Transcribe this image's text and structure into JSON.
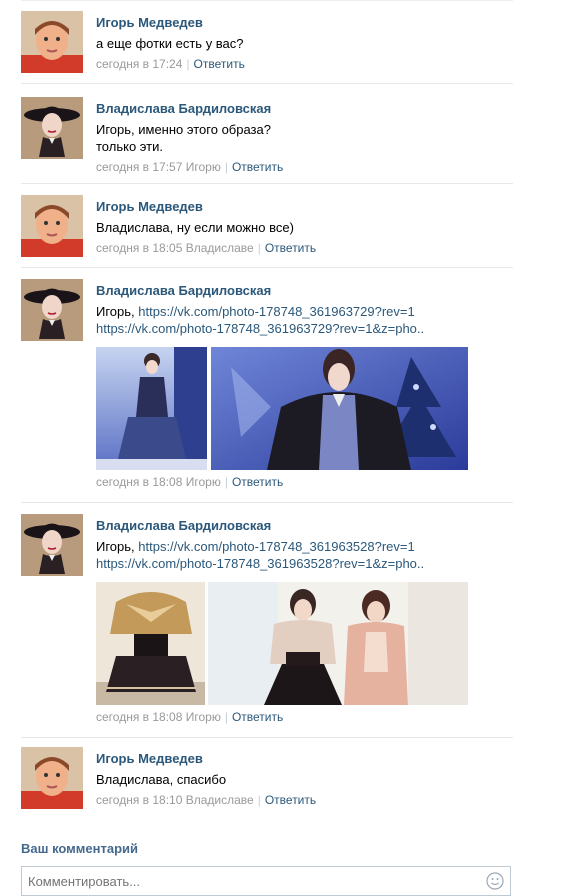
{
  "comments": [
    {
      "author": "Игорь Медведев",
      "avatar": "avatar-igor",
      "text": "а еще фотки есть у вас?",
      "time": "сегодня в 17:24",
      "reply_to": "",
      "reply_label": "Ответить"
    },
    {
      "author": "Владислава Бардиловская",
      "avatar": "avatar-vladislava",
      "text": "Игорь, именно этого образа?\nтолько эти.",
      "time": "сегодня в 17:57 Игорю",
      "reply_label": "Ответить"
    },
    {
      "author": "Игорь Медведев",
      "avatar": "avatar-igor",
      "text": "Владислава, ну если можно все)",
      "time": "сегодня в 18:05 Владиславе",
      "reply_label": "Ответить"
    },
    {
      "author": "Владислава Бардиловская",
      "avatar": "avatar-vladislava",
      "text_prefix": "Игорь, ",
      "link1": "https://vk.com/photo-178748_361963729?rev=1",
      "link2": "https://vk.com/photo-178748_361963729?rev=1&z=pho..",
      "time": "сегодня в 18:08 Игорю",
      "reply_label": "Ответить"
    },
    {
      "author": "Владислава Бардиловская",
      "avatar": "avatar-vladislava",
      "text_prefix": "Игорь, ",
      "link1": "https://vk.com/photo-178748_361963528?rev=1",
      "link2": "https://vk.com/photo-178748_361963528?rev=1&z=pho..",
      "time": "сегодня в 18:08 Игорю",
      "reply_label": "Ответить"
    },
    {
      "author": "Игорь Медведев",
      "avatar": "avatar-igor",
      "text": "Владислава, спасибо",
      "time": "сегодня в 18:10 Владиславе",
      "reply_label": "Ответить"
    }
  ],
  "composer": {
    "title": "Ваш комментарий",
    "placeholder": "Комментировать..."
  },
  "colors": {
    "link": "#2b587a",
    "meta": "#999999",
    "divider": "#e7e8ec",
    "photo_blue": "#3a4fa8"
  }
}
